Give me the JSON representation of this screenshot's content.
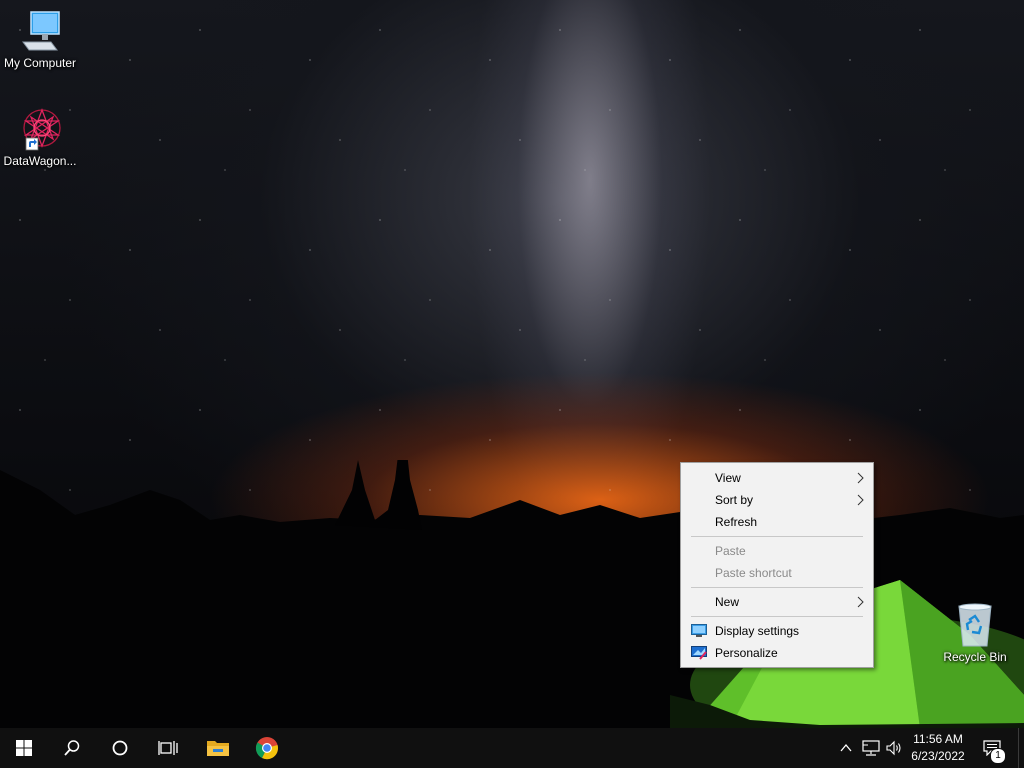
{
  "desktop": {
    "icons": [
      {
        "label": "My Computer",
        "icon": "computer-icon"
      },
      {
        "label": "DataWagon...",
        "icon": "datawagon-shortcut-icon"
      },
      {
        "label": "Recycle Bin",
        "icon": "recycle-bin-icon"
      }
    ]
  },
  "context_menu": {
    "items": [
      {
        "label": "View",
        "has_submenu": true,
        "enabled": true
      },
      {
        "label": "Sort by",
        "has_submenu": true,
        "enabled": true
      },
      {
        "label": "Refresh",
        "has_submenu": false,
        "enabled": true
      },
      {
        "label": "Paste",
        "has_submenu": false,
        "enabled": false
      },
      {
        "label": "Paste shortcut",
        "has_submenu": false,
        "enabled": false
      },
      {
        "label": "New",
        "has_submenu": true,
        "enabled": true
      },
      {
        "label": "Display settings",
        "icon": "display-settings-icon",
        "enabled": true
      },
      {
        "label": "Personalize",
        "icon": "personalize-icon",
        "enabled": true
      }
    ]
  },
  "taskbar": {
    "buttons": [
      "start-button",
      "search-button",
      "cortana-button",
      "task-view-button",
      "file-explorer-button",
      "chrome-button"
    ],
    "tray": {
      "icons": [
        "chevron-up-icon",
        "network-icon",
        "volume-icon"
      ],
      "time": "11:56 AM",
      "date": "6/23/2022",
      "notification_count": "1"
    }
  },
  "colors": {
    "taskbar": "#101010",
    "menu_bg": "#f2f2f2",
    "windows_blue": "#0078d7",
    "folder_yellow": "#f5c242"
  }
}
